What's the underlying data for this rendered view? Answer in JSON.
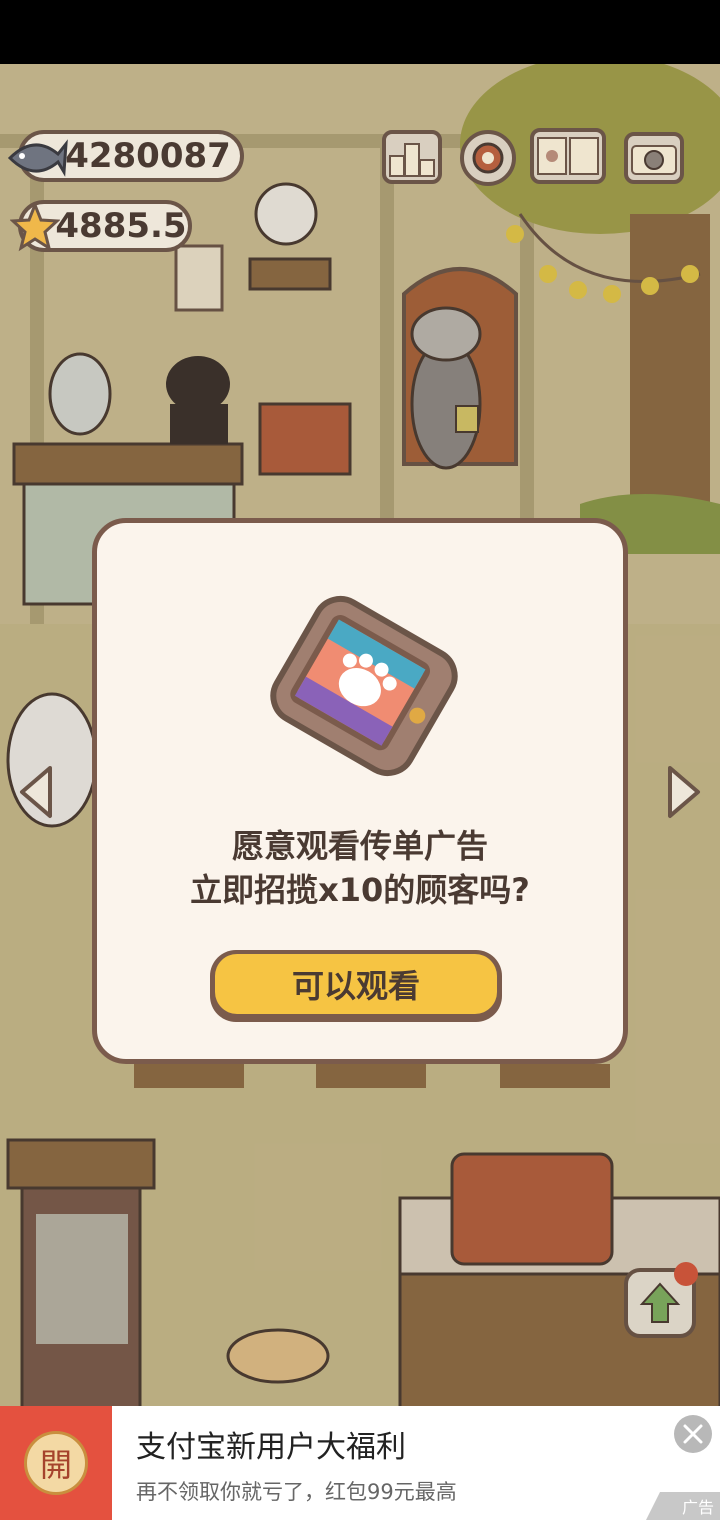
{
  "hud": {
    "fish_count": "4280087",
    "star_count": "4885.5",
    "icons": [
      "ranking-icon",
      "settings-icon",
      "cat-book-icon",
      "camera-icon"
    ]
  },
  "dialog": {
    "line1": "愿意观看传单广告",
    "line2": "立即招揽x10的顾客吗?",
    "confirm_label": "可以观看",
    "image": "flyer-tablet-icon"
  },
  "nav": {
    "left": "arrow-left-icon",
    "right": "arrow-right-icon"
  },
  "ad_banner": {
    "badge_char": "開",
    "title": "支付宝新用户大福利",
    "subtitle": "再不领取你就亏了，红包99元最高",
    "tag": "广告",
    "close": "close-icon"
  },
  "colors": {
    "dialog_bg": "#fbf4ec",
    "dialog_border": "#7b5b4c",
    "button_yellow": "#f6c443",
    "ad_red": "#e4513f"
  }
}
